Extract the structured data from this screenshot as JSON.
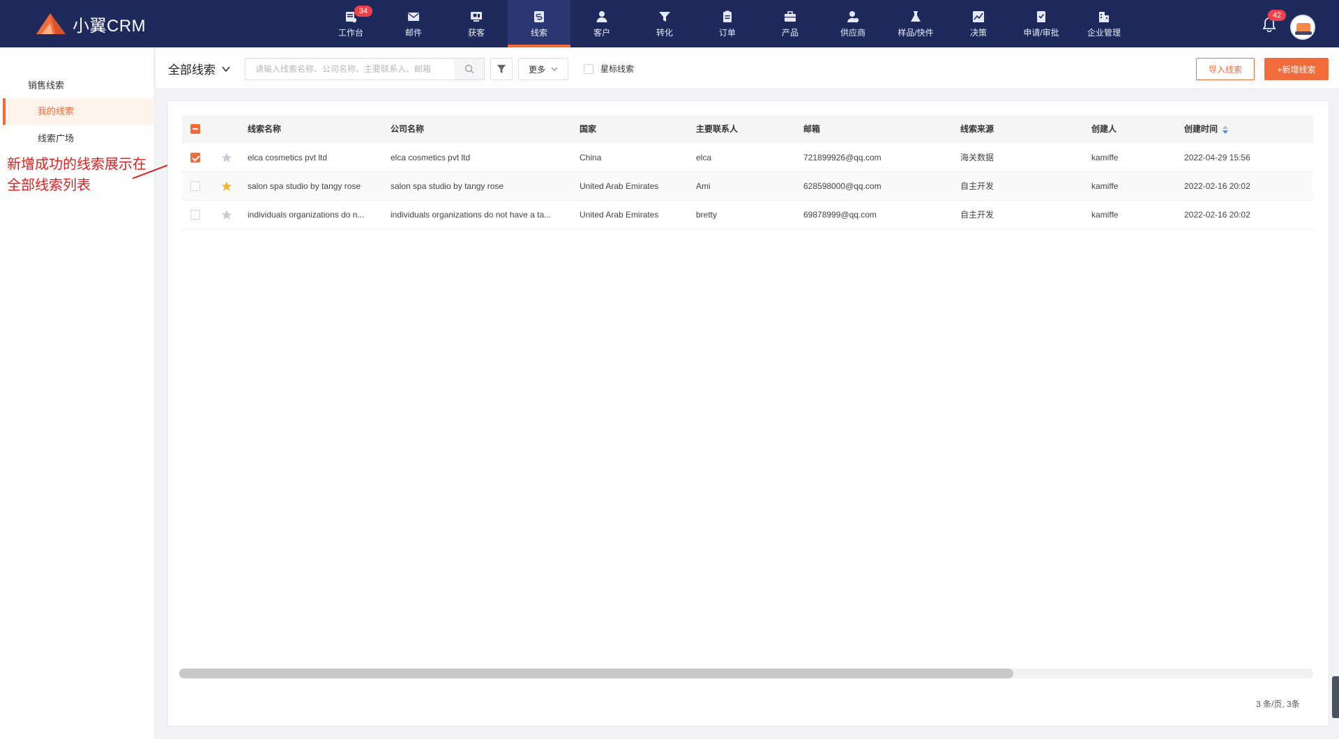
{
  "app": {
    "name": "小翼CRM",
    "brand_color": "#f26b3a",
    "nav_bg": "#1f2a5c"
  },
  "nav": {
    "items": [
      {
        "label": "工作台",
        "icon": "dashboard-icon",
        "badge": "34"
      },
      {
        "label": "邮件",
        "icon": "mail-icon",
        "badge": ""
      },
      {
        "label": "获客",
        "icon": "acquire-icon",
        "badge": ""
      },
      {
        "label": "线索",
        "icon": "leads-icon",
        "badge": "",
        "active": true
      },
      {
        "label": "客户",
        "icon": "customer-icon",
        "badge": ""
      },
      {
        "label": "转化",
        "icon": "funnel-icon",
        "badge": ""
      },
      {
        "label": "订单",
        "icon": "order-icon",
        "badge": ""
      },
      {
        "label": "产品",
        "icon": "product-icon",
        "badge": ""
      },
      {
        "label": "供应商",
        "icon": "supplier-icon",
        "badge": ""
      },
      {
        "label": "样品/快件",
        "icon": "sample-icon",
        "badge": ""
      },
      {
        "label": "决策",
        "icon": "decision-icon",
        "badge": ""
      },
      {
        "label": "申请/审批",
        "icon": "approval-icon",
        "badge": ""
      },
      {
        "label": "企业管理",
        "icon": "company-icon",
        "badge": ""
      }
    ],
    "notification_count": "42"
  },
  "sidebar": {
    "heading": "销售线索",
    "items": [
      {
        "label": "我的线索",
        "active": true
      },
      {
        "label": "线索广场",
        "active": false
      }
    ]
  },
  "annotation": {
    "line1": "新增成功的线索展示在",
    "line2": "全部线索列表",
    "color": "#e02020"
  },
  "toolbar": {
    "view_label": "全部线索",
    "search_placeholder": "请输入线索名称、公司名称、主要联系人、邮箱",
    "more_label": "更多",
    "star_filter_label": "星标线索",
    "import_label": "导入线索",
    "add_label": "+新增线索"
  },
  "table": {
    "columns": [
      "线索名称",
      "公司名称",
      "国家",
      "主要联系人",
      "邮箱",
      "线索来源",
      "创建人",
      "创建时间"
    ],
    "rows": [
      {
        "checked": true,
        "starred": false,
        "name": "elca cosmetics pvt ltd",
        "company": "elca cosmetics pvt ltd",
        "country": "China",
        "contact": "elca",
        "email": "721899926@qq.com",
        "source": "海关数据",
        "creator": "kamiffe",
        "created": "2022-04-29 15:56"
      },
      {
        "checked": false,
        "starred": true,
        "name": "salon spa studio by tangy rose",
        "company": "salon spa studio by tangy rose",
        "country": "United Arab Emirates",
        "contact": "Ami",
        "email": "628598000@qq.com",
        "source": "自主开发",
        "creator": "kamiffe",
        "created": "2022-02-16 20:02"
      },
      {
        "checked": false,
        "starred": false,
        "name": "individuals organizations do n...",
        "company": "individuals organizations do not have a ta...",
        "country": "United Arab Emirates",
        "contact": "bretty",
        "email": "69878999@qq.com",
        "source": "自主开发",
        "creator": "kamiffe",
        "created": "2022-02-16 20:02"
      }
    ]
  },
  "pagination": {
    "summary": "3 条/页,  3条"
  }
}
